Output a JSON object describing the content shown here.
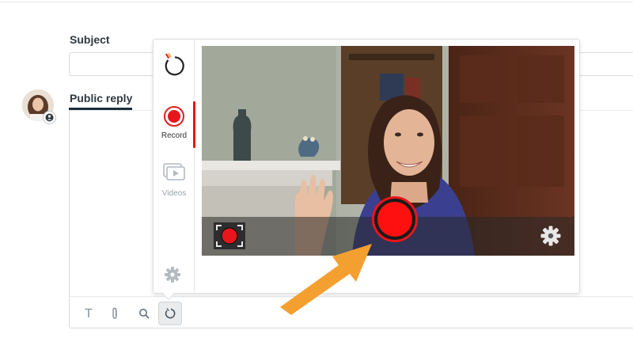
{
  "form": {
    "subject_label": "Subject",
    "public_reply_tab": "Public reply"
  },
  "recorder": {
    "rail": {
      "record_label": "Record",
      "videos_label": "Videos"
    }
  },
  "toolbar": {
    "format_text_glyph": "T"
  },
  "colors": {
    "record_red": "#e8151b",
    "callout_arrow": "#f4a030",
    "tab_underline": "#1f2d3a"
  },
  "icons": {
    "rail_logo": "refresh-logo-icon",
    "rail_record": "record-icon",
    "rail_videos": "video-library-icon",
    "rail_settings": "gear-icon",
    "fullscreen": "fullscreen-record-icon",
    "record_button": "record-button-icon",
    "video_settings": "gear-icon",
    "toolbar_attach": "paperclip-icon",
    "toolbar_search": "search-icon",
    "toolbar_recorder": "refresh-logo-icon"
  }
}
